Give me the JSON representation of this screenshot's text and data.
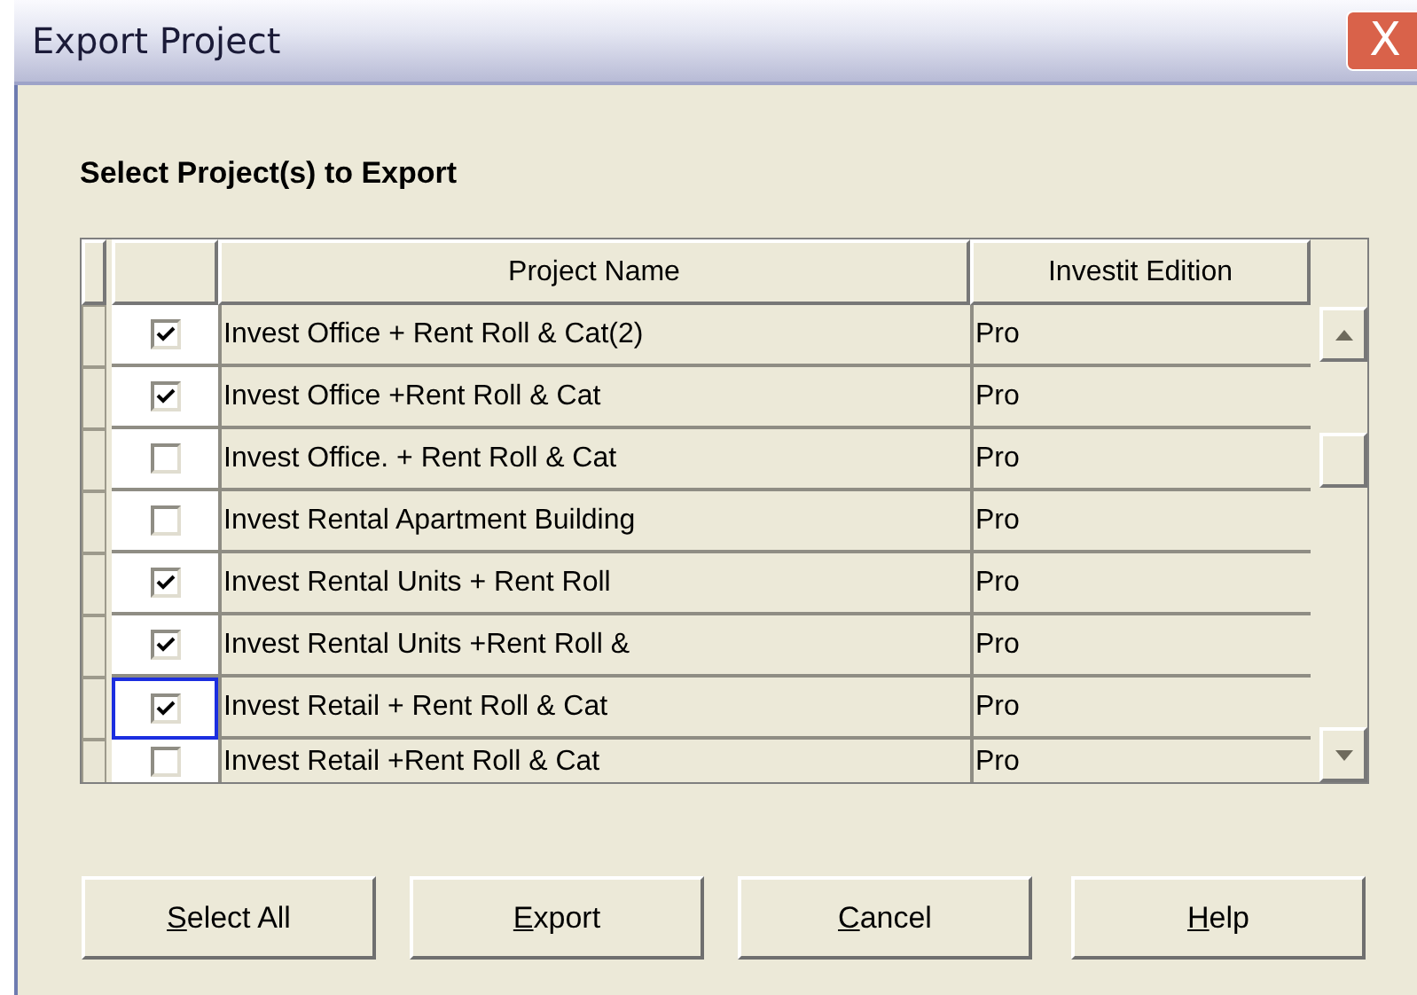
{
  "window": {
    "title": "Export Project",
    "close_glyph": "X"
  },
  "heading": "Select Project(s) to Export",
  "table": {
    "columns": [
      "Project Name",
      "Investit Edition"
    ],
    "rows": [
      {
        "checked": true,
        "focused": false,
        "name": "Invest Office + Rent Roll & Cat(2)",
        "edition": "Pro"
      },
      {
        "checked": true,
        "focused": false,
        "name": "Invest Office +Rent Roll & Cat",
        "edition": "Pro"
      },
      {
        "checked": false,
        "focused": false,
        "name": "Invest Office. + Rent Roll & Cat",
        "edition": "Pro"
      },
      {
        "checked": false,
        "focused": false,
        "name": "Invest Rental Apartment Building",
        "edition": "Pro"
      },
      {
        "checked": true,
        "focused": false,
        "name": "Invest Rental Units + Rent Roll",
        "edition": "Pro"
      },
      {
        "checked": true,
        "focused": false,
        "name": "Invest Rental Units +Rent Roll &",
        "edition": "Pro"
      },
      {
        "checked": true,
        "focused": true,
        "name": "Invest Retail + Rent Roll & Cat",
        "edition": "Pro"
      },
      {
        "checked": false,
        "focused": false,
        "name": "Invest Retail +Rent Roll & Cat",
        "edition": "Pro"
      }
    ]
  },
  "buttons": [
    "Select All",
    "Export",
    "Cancel",
    "Help"
  ]
}
